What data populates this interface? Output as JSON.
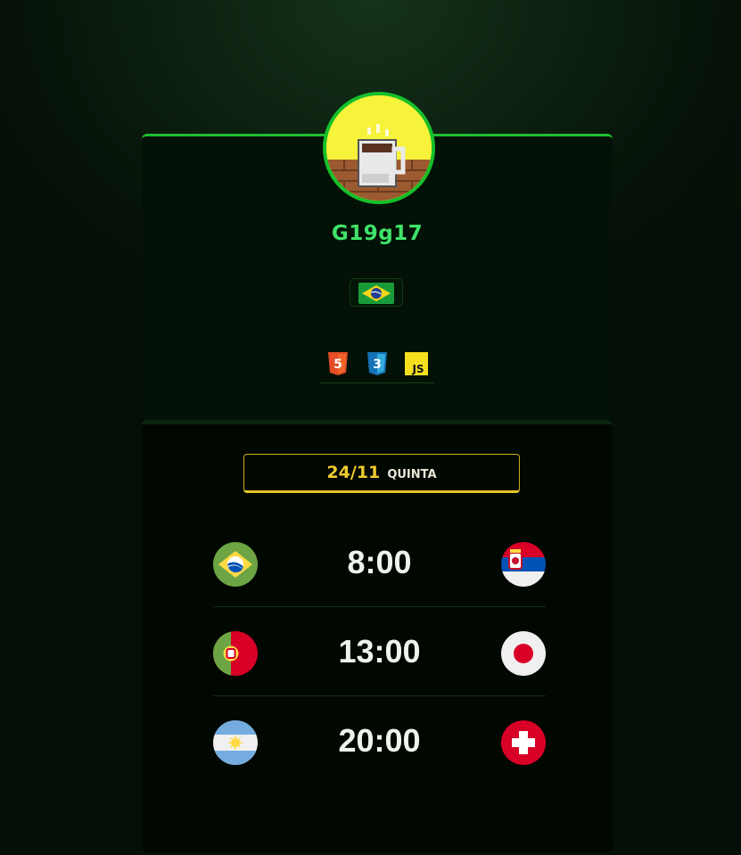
{
  "profile": {
    "username": "G19g17",
    "avatar_icon": "coffee-mug-icon",
    "country_flag": "brazil-flag-icon",
    "tech_stack": [
      {
        "icon": "html5-icon",
        "label": "5"
      },
      {
        "icon": "css3-icon",
        "label": "3"
      },
      {
        "icon": "javascript-icon",
        "label": "JS"
      }
    ]
  },
  "schedule": {
    "date": "24/11",
    "weekday": "QUINTA",
    "matches": [
      {
        "home": "brazil-flag-icon",
        "time": "8:00",
        "away": "serbia-flag-icon"
      },
      {
        "home": "portugal-flag-icon",
        "time": "13:00",
        "away": "japan-flag-icon"
      },
      {
        "home": "argentina-flag-icon",
        "time": "20:00",
        "away": "switzerland-flag-icon"
      }
    ]
  },
  "colors": {
    "accent_green": "#1fbf2e",
    "username_green": "#3fe36a",
    "date_gold": "#f0cc2b",
    "background_dark": "#020a03"
  }
}
